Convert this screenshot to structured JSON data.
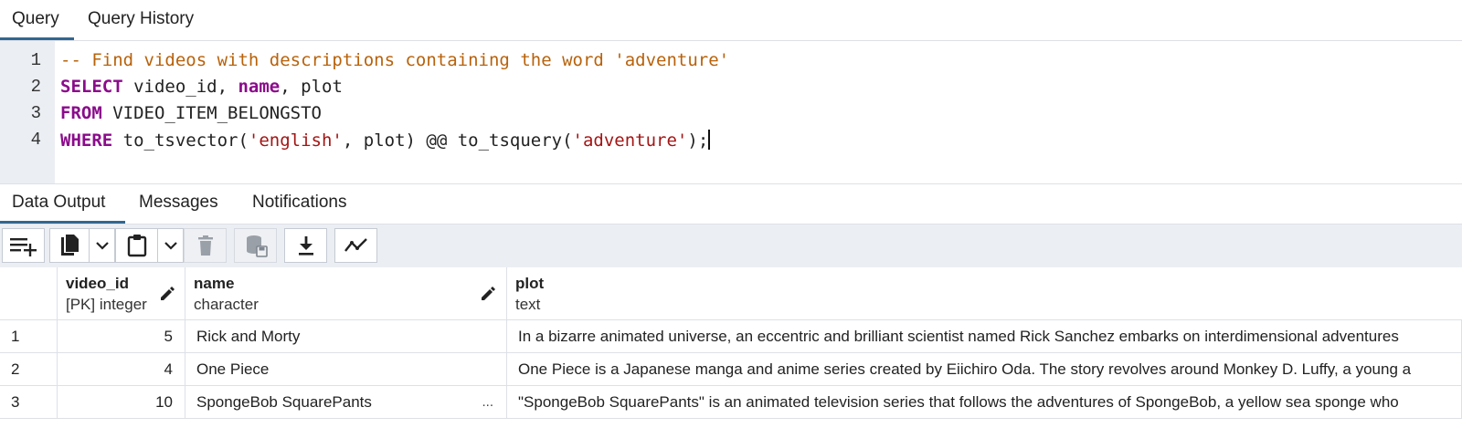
{
  "top_tabs": [
    "Query",
    "Query History"
  ],
  "editor": {
    "line_numbers": [
      "1",
      "2",
      "3",
      "4"
    ],
    "lines": {
      "l1": "-- Find videos with descriptions containing the word 'adventure'",
      "l2_kw": "SELECT",
      "l2_a": " video_id, ",
      "l2_kw2": "name",
      "l2_b": ", plot",
      "l3_kw": "FROM",
      "l3_a": " VIDEO_ITEM_BELONGSTO",
      "l4_kw": "WHERE",
      "l4_a": " to_tsvector(",
      "l4_s1": "'english'",
      "l4_b": ", plot) @@ to_tsquery(",
      "l4_s2": "'adventure'",
      "l4_c": ");"
    }
  },
  "bottom_tabs": [
    "Data Output",
    "Messages",
    "Notifications"
  ],
  "toolbar": {
    "icons": [
      "add-row-icon",
      "copy-icon",
      "chevron-down-icon",
      "paste-icon",
      "chevron-down-icon",
      "delete-icon",
      "save-data-icon",
      "download-icon",
      "graph-icon"
    ],
    "colors": {
      "background": "#ebeef3",
      "accent": "#326690"
    }
  },
  "grid": {
    "columns": [
      {
        "name": "video_id",
        "type": "[PK] integer"
      },
      {
        "name": "name",
        "type": "character"
      },
      {
        "name": "plot",
        "type": "text"
      }
    ],
    "rows": [
      {
        "num": "1",
        "video_id": "5",
        "name": "Rick and Morty",
        "plot": "In a bizarre animated universe, an eccentric and brilliant scientist named Rick Sanchez embarks on interdimensional adventures"
      },
      {
        "num": "2",
        "video_id": "4",
        "name": "One Piece",
        "plot": "One Piece is a Japanese manga and anime series created by Eiichiro Oda. The story revolves around Monkey D. Luffy, a young a"
      },
      {
        "num": "3",
        "video_id": "10",
        "name": "SpongeBob SquarePants",
        "name_ellipsis": "...",
        "plot": "\"SpongeBob SquarePants\" is an animated television series that follows the adventures of SpongeBob, a yellow sea sponge who"
      }
    ]
  }
}
